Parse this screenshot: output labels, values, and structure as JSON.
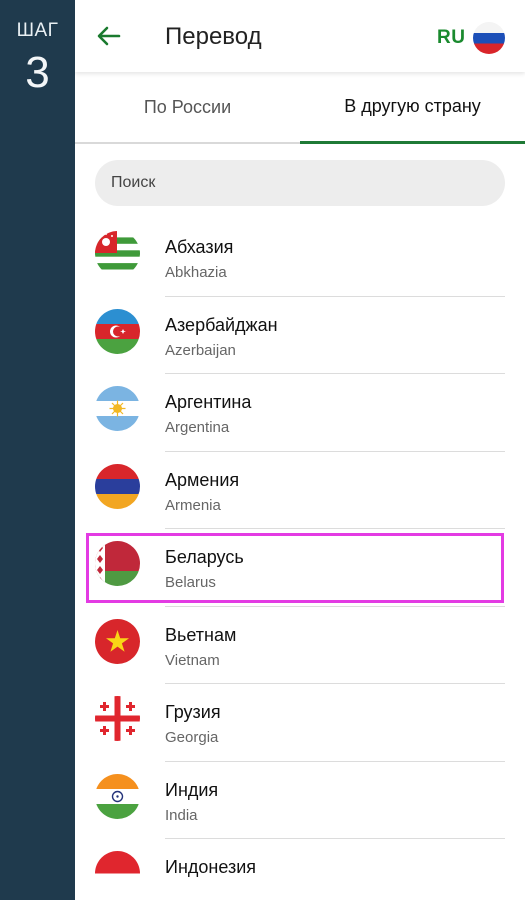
{
  "step": {
    "label": "ШАГ",
    "number": "3"
  },
  "appbar": {
    "title": "Перевод",
    "lang_code": "RU"
  },
  "tabs": [
    {
      "label": "По России",
      "active": false
    },
    {
      "label": "В другую страну",
      "active": true
    }
  ],
  "search": {
    "placeholder": "Поиск"
  },
  "countries": [
    {
      "ru": "Абхазия",
      "en": "Abkhazia",
      "flag_icon": "abkhazia-flag-icon"
    },
    {
      "ru": "Азербайджан",
      "en": "Azerbaijan",
      "flag_icon": "azerbaijan-flag-icon"
    },
    {
      "ru": "Аргентина",
      "en": "Argentina",
      "flag_icon": "argentina-flag-icon"
    },
    {
      "ru": "Армения",
      "en": "Armenia",
      "flag_icon": "armenia-flag-icon"
    },
    {
      "ru": "Беларусь",
      "en": "Belarus",
      "flag_icon": "belarus-flag-icon",
      "highlighted": true
    },
    {
      "ru": "Вьетнам",
      "en": "Vietnam",
      "flag_icon": "vietnam-flag-icon"
    },
    {
      "ru": "Грузия",
      "en": "Georgia",
      "flag_icon": "georgia-flag-icon"
    },
    {
      "ru": "Индия",
      "en": "India",
      "flag_icon": "india-flag-icon"
    },
    {
      "ru": "Индонезия",
      "en": "",
      "flag_icon": "indonesia-flag-icon"
    }
  ],
  "colors": {
    "rail": "#1f3a4d",
    "accent_green": "#1a8a2e",
    "tab_indicator": "#1f7a36",
    "highlight": "#e33be3"
  }
}
